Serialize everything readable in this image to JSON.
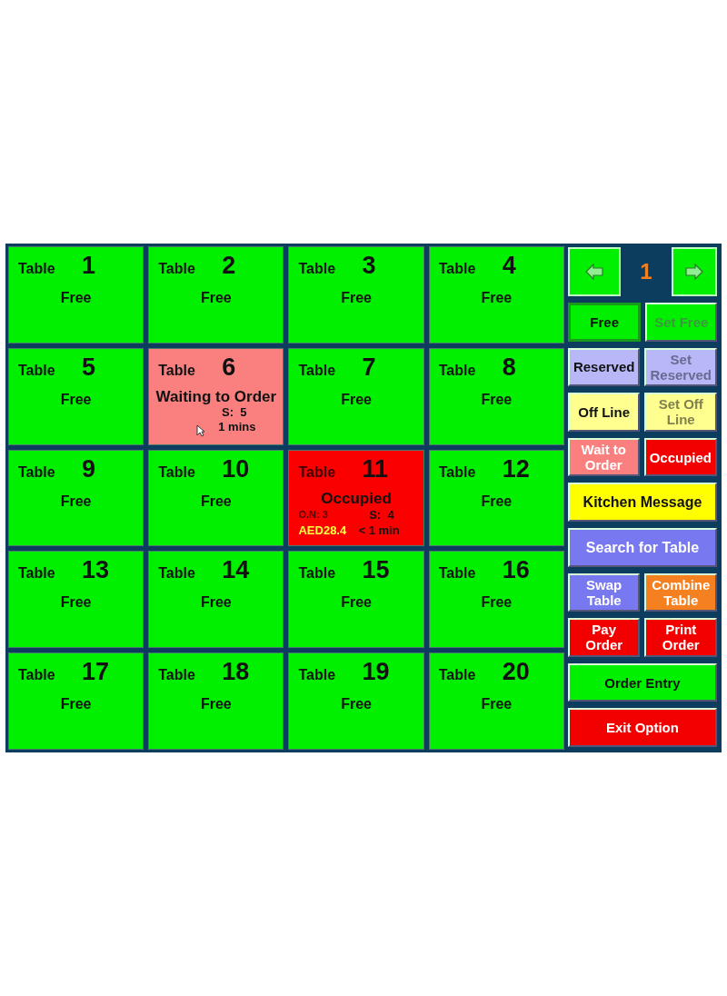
{
  "tables": [
    {
      "label": "Table",
      "number": "1",
      "kind": "free",
      "status": "Free"
    },
    {
      "label": "Table",
      "number": "2",
      "kind": "free",
      "status": "Free"
    },
    {
      "label": "Table",
      "number": "3",
      "kind": "free",
      "status": "Free"
    },
    {
      "label": "Table",
      "number": "4",
      "kind": "free",
      "status": "Free"
    },
    {
      "label": "Table",
      "number": "5",
      "kind": "free",
      "status": "Free"
    },
    {
      "label": "Table",
      "number": "6",
      "kind": "waiting",
      "status": "Waiting to Order",
      "seats": "S:  5",
      "time": "1 mins"
    },
    {
      "label": "Table",
      "number": "7",
      "kind": "free",
      "status": "Free"
    },
    {
      "label": "Table",
      "number": "8",
      "kind": "free",
      "status": "Free"
    },
    {
      "label": "Table",
      "number": "9",
      "kind": "free",
      "status": "Free"
    },
    {
      "label": "Table",
      "number": "10",
      "kind": "free",
      "status": "Free"
    },
    {
      "label": "Table",
      "number": "11",
      "kind": "occupied",
      "status": "Occupied",
      "order": "O.N: 3",
      "seats": "S:  4",
      "amount": "AED28.4",
      "time": "< 1 min"
    },
    {
      "label": "Table",
      "number": "12",
      "kind": "free",
      "status": "Free"
    },
    {
      "label": "Table",
      "number": "13",
      "kind": "free",
      "status": "Free"
    },
    {
      "label": "Table",
      "number": "14",
      "kind": "free",
      "status": "Free"
    },
    {
      "label": "Table",
      "number": "15",
      "kind": "free",
      "status": "Free"
    },
    {
      "label": "Table",
      "number": "16",
      "kind": "free",
      "status": "Free"
    },
    {
      "label": "Table",
      "number": "17",
      "kind": "free",
      "status": "Free"
    },
    {
      "label": "Table",
      "number": "18",
      "kind": "free",
      "status": "Free"
    },
    {
      "label": "Table",
      "number": "19",
      "kind": "free",
      "status": "Free"
    },
    {
      "label": "Table",
      "number": "20",
      "kind": "free",
      "status": "Free"
    }
  ],
  "pager": {
    "page": "1"
  },
  "button_rows": [
    [
      {
        "label": "Free",
        "kind": "green",
        "disabled": false,
        "selected": true
      },
      {
        "label": "Set Free",
        "kind": "green",
        "disabled": true,
        "selected": false
      }
    ],
    [
      {
        "label": "Reserved",
        "kind": "lavender",
        "disabled": false,
        "selected": false
      },
      {
        "label": "Set Reserved",
        "kind": "lavender",
        "disabled": true,
        "selected": false
      }
    ],
    [
      {
        "label": "Off Line",
        "kind": "yellow-light",
        "disabled": false,
        "selected": false
      },
      {
        "label": "Set Off Line",
        "kind": "yellow-light",
        "disabled": true,
        "selected": false
      }
    ],
    [
      {
        "label": "Wait to Order",
        "kind": "pink",
        "disabled": false,
        "selected": false
      },
      {
        "label": "Occupied",
        "kind": "red",
        "disabled": false,
        "selected": false
      }
    ],
    [
      {
        "label": "Kitchen Message",
        "kind": "yellow",
        "disabled": false,
        "selected": false
      }
    ],
    [
      {
        "label": "Search for Table",
        "kind": "purple",
        "disabled": false,
        "selected": false
      }
    ],
    [
      {
        "label": "Swap Table",
        "kind": "purple",
        "disabled": false,
        "selected": false
      },
      {
        "label": "Combine Table",
        "kind": "orange",
        "disabled": false,
        "selected": false
      }
    ],
    [
      {
        "label": "Pay Order",
        "kind": "red",
        "disabled": false,
        "selected": false
      },
      {
        "label": "Print Order",
        "kind": "red",
        "disabled": false,
        "selected": false
      }
    ],
    [
      {
        "label": "Order Entry",
        "kind": "green",
        "disabled": false,
        "selected": false
      }
    ],
    [
      {
        "label": "Exit Option",
        "kind": "red",
        "disabled": false,
        "selected": false
      }
    ]
  ]
}
